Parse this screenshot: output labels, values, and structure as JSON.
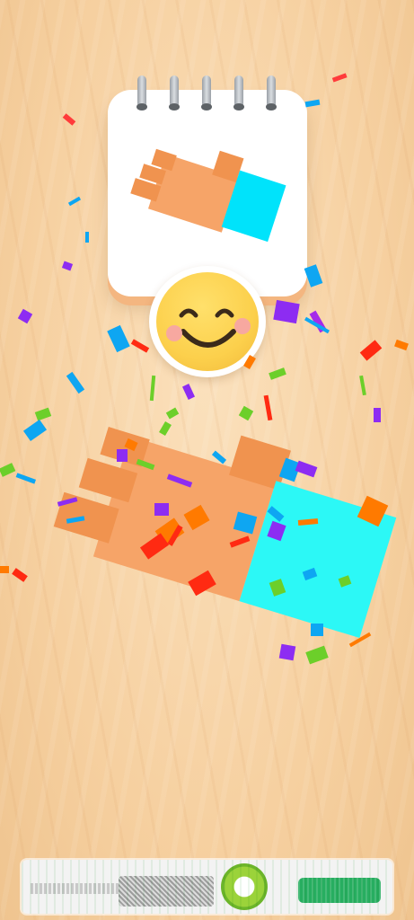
{
  "scene": {
    "type": "level-complete-celebration",
    "result_icon": "thumbs-up-icon",
    "reaction": "smiley-face-icon"
  },
  "puzzle": {
    "shape": "thumbs-up",
    "colors": {
      "hand": "#f6a468",
      "hand_dark": "#f0934f",
      "cuff": "#2cf8f6",
      "cuff_icon": "#00e3fb"
    }
  },
  "confetti_colors": [
    "#8d2cf2",
    "#0ea6f2",
    "#ff7a00",
    "#ff2a12",
    "#6ccf2a",
    "#ff3b3b",
    "#a52bea"
  ],
  "ad_banner": {
    "visible": true,
    "icon": "ad-logo-icon"
  }
}
